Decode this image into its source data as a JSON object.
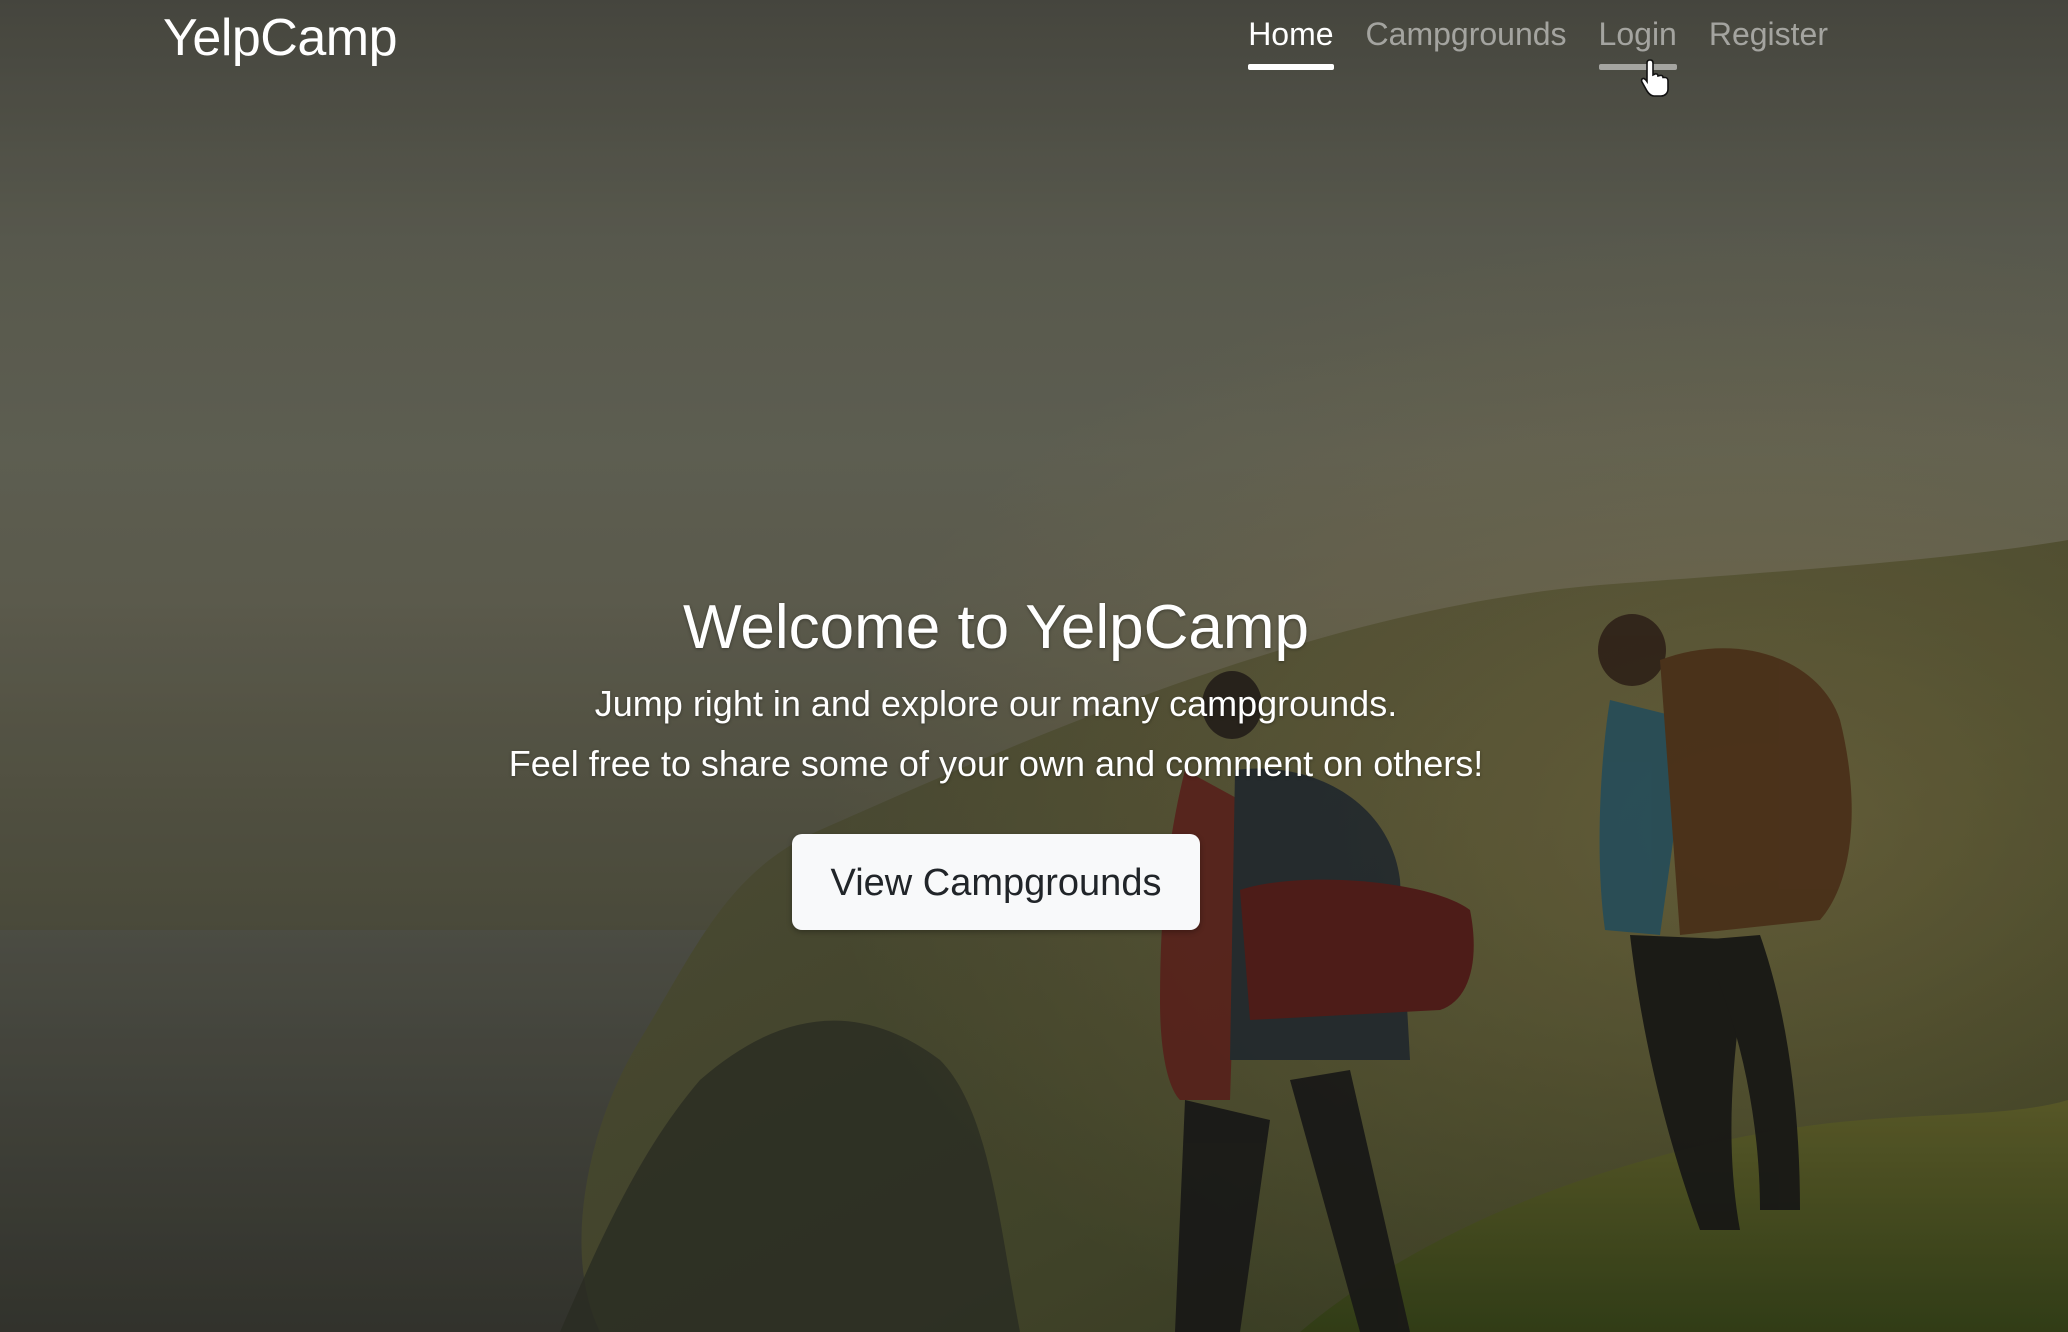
{
  "navbar": {
    "brand": "YelpCamp",
    "links": [
      {
        "label": "Home",
        "state": "active"
      },
      {
        "label": "Campgrounds",
        "state": "inactive"
      },
      {
        "label": "Login",
        "state": "hover"
      },
      {
        "label": "Register",
        "state": "inactive"
      }
    ]
  },
  "hero": {
    "title": "Welcome to YelpCamp",
    "line1": "Jump right in and explore our many campgrounds.",
    "line2": "Feel free to share some of your own and comment on others!",
    "button_label": "View Campgrounds"
  },
  "colors": {
    "nav_active": "#ffffff",
    "nav_inactive": "rgba(255,255,255,0.5)",
    "button_bg": "#f8f9fa",
    "button_text": "#212529"
  },
  "icons": {
    "cursor": "pointer-hand-icon"
  }
}
